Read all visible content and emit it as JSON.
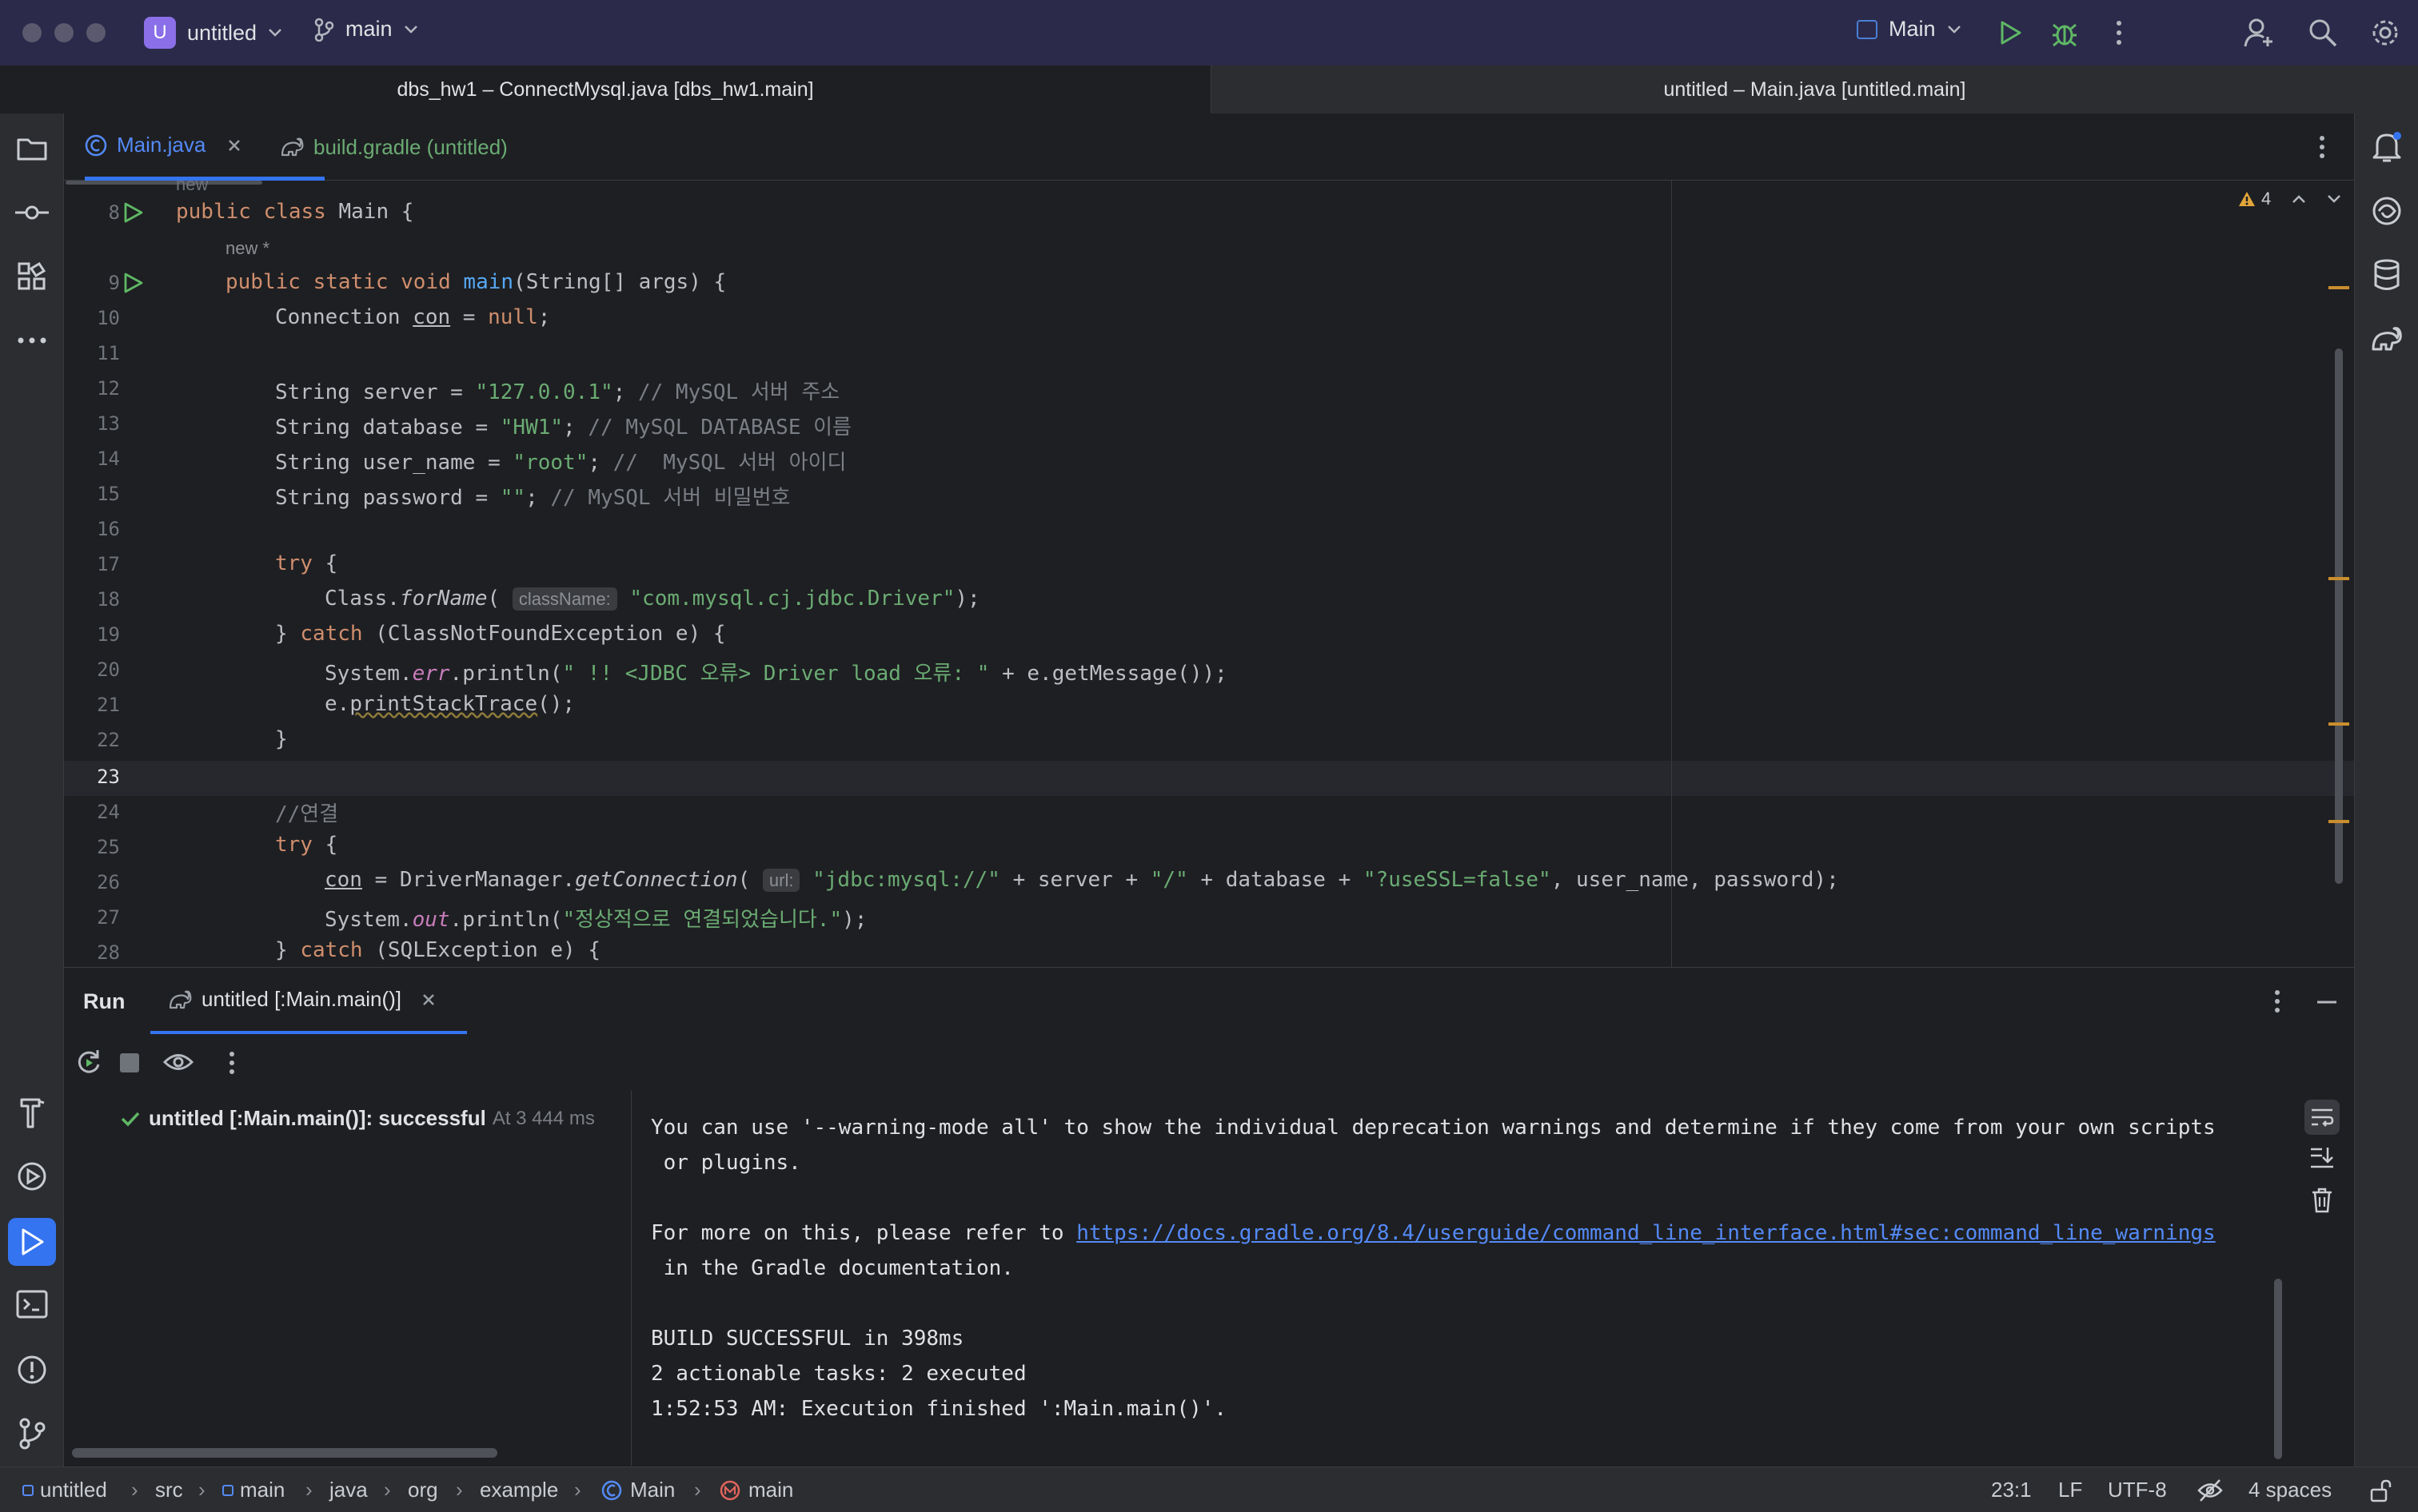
{
  "titlebar": {
    "project_badge": "U",
    "project_name": "untitled",
    "branch": "main",
    "run_config": "Main"
  },
  "window_tabs": [
    {
      "label": "dbs_hw1 – ConnectMysql.java [dbs_hw1.main]"
    },
    {
      "label": "untitled – Main.java [untitled.main]"
    }
  ],
  "editor_tabs": [
    {
      "label": "Main.java"
    },
    {
      "label": "build.gradle (untitled)"
    }
  ],
  "editor": {
    "warning_count": "4",
    "new_hint_top": "new",
    "new_hint": "new *",
    "current_line": "23",
    "line_numbers": [
      "8",
      "9",
      "10",
      "11",
      "12",
      "13",
      "14",
      "15",
      "16",
      "17",
      "18",
      "19",
      "20",
      "21",
      "22",
      "23",
      "24",
      "25",
      "26",
      "27",
      "28"
    ],
    "hints": {
      "classname": "className:",
      "url": "url:"
    }
  },
  "run_panel": {
    "title": "Run",
    "tab_label": "untitled [:Main.main()]",
    "tree_item": "untitled [:Main.main()]: successful",
    "tree_time": "At 3 444 ms",
    "console": {
      "line1": "You can use '--warning-mode all' to show the individual deprecation warnings and determine if they come from your own scripts",
      "line2": " or plugins.",
      "line3_prefix": "For more on this, please refer to ",
      "line3_link": "https://docs.gradle.org/8.4/userguide/command_line_interface.html#sec:command_line_warnings",
      "line4": " in the Gradle documentation.",
      "line5": "BUILD SUCCESSFUL in 398ms",
      "line6": "2 actionable tasks: 2 executed",
      "line7": "1:52:53 AM: Execution finished ':Main.main()'."
    }
  },
  "statusbar": {
    "breadcrumb": [
      "untitled",
      "src",
      "main",
      "java",
      "org",
      "example",
      "Main",
      "main"
    ],
    "position": "23:1",
    "line_sep": "LF",
    "encoding": "UTF-8",
    "indent": "4 spaces"
  },
  "colors": {
    "titlebar_bg": "#2b2a4a",
    "editor_bg": "#1e1f22",
    "accent": "#3574f0",
    "keyword": "#cf8e6d",
    "string": "#6aab73",
    "run_green": "#5fb865"
  }
}
